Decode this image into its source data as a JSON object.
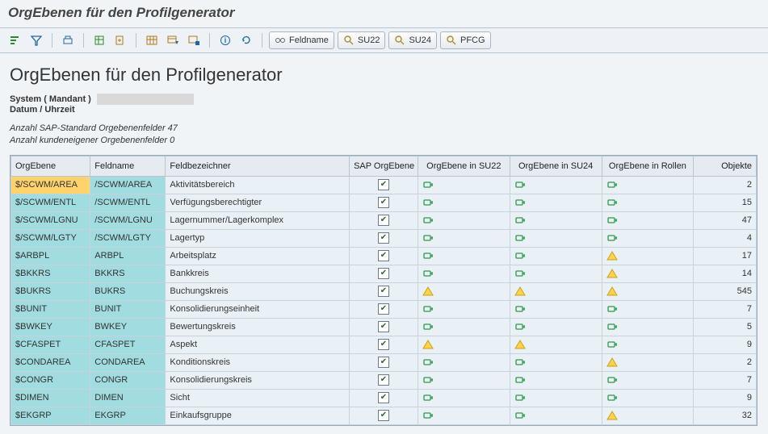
{
  "window_title": "OrgEbenen für den Profilgenerator",
  "page_title": "OrgEbenen für den Profilgenerator",
  "toolbar": {
    "feldname": "Feldname",
    "su22": "SU22",
    "su24": "SU24",
    "pfcg": "PFCG"
  },
  "meta": {
    "system_label": "System ( Mandant )",
    "date_label": "Datum / Uhrzeit"
  },
  "counts": {
    "sap": "Anzahl SAP-Standard Orgebenenfelder 47",
    "cust": "Anzahl kundeneigener Orgebenenfelder 0"
  },
  "columns": {
    "org": "OrgEbene",
    "field": "Feldname",
    "desc": "Feldbezeichner",
    "sap": "SAP OrgEbene",
    "su22": "OrgEbene in SU22",
    "su24": "OrgEbene in SU24",
    "roles": "OrgEbene in Rollen",
    "obj": "Objekte"
  },
  "rows": [
    {
      "org": "$/SCWM/AREA",
      "field": "/SCWM/AREA",
      "desc": "Aktivitätsbereich",
      "sap": true,
      "su22": "ok",
      "su24": "ok",
      "roles": "ok",
      "obj": 2,
      "selected": true
    },
    {
      "org": "$/SCWM/ENTL",
      "field": "/SCWM/ENTL",
      "desc": "Verfügungsberechtigter",
      "sap": true,
      "su22": "ok",
      "su24": "ok",
      "roles": "ok",
      "obj": 15
    },
    {
      "org": "$/SCWM/LGNU",
      "field": "/SCWM/LGNU",
      "desc": "Lagernummer/Lagerkomplex",
      "sap": true,
      "su22": "ok",
      "su24": "ok",
      "roles": "ok",
      "obj": 47
    },
    {
      "org": "$/SCWM/LGTY",
      "field": "/SCWM/LGTY",
      "desc": "Lagertyp",
      "sap": true,
      "su22": "ok",
      "su24": "ok",
      "roles": "ok",
      "obj": 4
    },
    {
      "org": "$ARBPL",
      "field": "ARBPL",
      "desc": "Arbeitsplatz",
      "sap": true,
      "su22": "ok",
      "su24": "ok",
      "roles": "warn",
      "obj": 17
    },
    {
      "org": "$BKKRS",
      "field": "BKKRS",
      "desc": "Bankkreis",
      "sap": true,
      "su22": "ok",
      "su24": "ok",
      "roles": "warn",
      "obj": 14
    },
    {
      "org": "$BUKRS",
      "field": "BUKRS",
      "desc": "Buchungskreis",
      "sap": true,
      "su22": "warn",
      "su24": "warn",
      "roles": "warn",
      "obj": 545
    },
    {
      "org": "$BUNIT",
      "field": "BUNIT",
      "desc": "Konsolidierungseinheit",
      "sap": true,
      "su22": "ok",
      "su24": "ok",
      "roles": "ok",
      "obj": 7
    },
    {
      "org": "$BWKEY",
      "field": "BWKEY",
      "desc": "Bewertungskreis",
      "sap": true,
      "su22": "ok",
      "su24": "ok",
      "roles": "ok",
      "obj": 5
    },
    {
      "org": "$CFASPET",
      "field": "CFASPET",
      "desc": "Aspekt",
      "sap": true,
      "su22": "warn",
      "su24": "warn",
      "roles": "ok",
      "obj": 9
    },
    {
      "org": "$CONDAREA",
      "field": "CONDAREA",
      "desc": "Konditionskreis",
      "sap": true,
      "su22": "ok",
      "su24": "ok",
      "roles": "warn",
      "obj": 2
    },
    {
      "org": "$CONGR",
      "field": "CONGR",
      "desc": "Konsolidierungskreis",
      "sap": true,
      "su22": "ok",
      "su24": "ok",
      "roles": "ok",
      "obj": 7
    },
    {
      "org": "$DIMEN",
      "field": "DIMEN",
      "desc": "Sicht",
      "sap": true,
      "su22": "ok",
      "su24": "ok",
      "roles": "ok",
      "obj": 9
    },
    {
      "org": "$EKGRP",
      "field": "EKGRP",
      "desc": "Einkaufsgruppe",
      "sap": true,
      "su22": "ok",
      "su24": "ok",
      "roles": "warn",
      "obj": 32
    }
  ]
}
